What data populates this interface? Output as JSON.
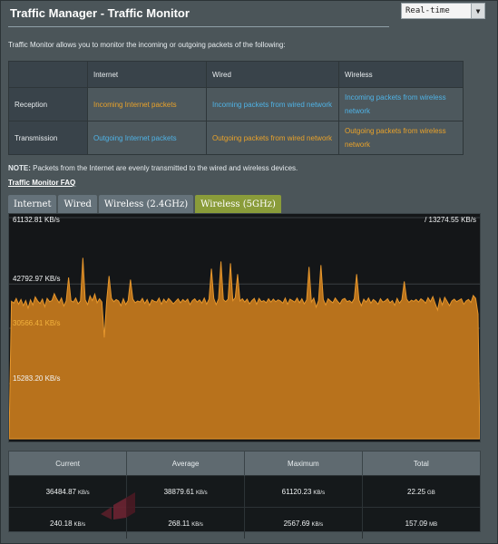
{
  "header": {
    "title": "Traffic Manager - Traffic Monitor",
    "mode_select": "Real-time"
  },
  "intro": "Traffic Monitor allows you to monitor the incoming or outgoing packets of the following:",
  "flow_table": {
    "columns": [
      "",
      "Internet",
      "Wired",
      "Wireless"
    ],
    "rows": [
      {
        "label": "Reception",
        "internet": "Incoming Internet packets",
        "wired": "Incoming packets from wired network",
        "wireless": "Incoming packets from wireless network"
      },
      {
        "label": "Transmission",
        "internet": "Outgoing Internet packets",
        "wired": "Outgoing packets from wired network",
        "wireless": "Outgoing packets from wireless network"
      }
    ]
  },
  "note": {
    "prefix": "NOTE:",
    "text": " Packets from the Internet are evenly transmitted to the wired and wireless devices."
  },
  "faq_link": "Traffic Monitor FAQ",
  "tabs": [
    "Internet",
    "Wired",
    "Wireless (2.4GHz)",
    "Wireless (5GHz)"
  ],
  "active_tab": 3,
  "colors": {
    "reception": "#f2a92a",
    "transmission": "#49b0ea",
    "active_tab": "#8a9c3a"
  },
  "chart_data": {
    "type": "area",
    "ylim": [
      0,
      61132.81
    ],
    "y_ticks": [
      "61132.81 KB/s",
      "42792.97 KB/s",
      "30566.41 KB/s",
      "15283.20 KB/s"
    ],
    "top_right": "/ 13274.55 KB/s",
    "series": [
      {
        "name": "Reception",
        "values": [
          0,
          38000,
          37500,
          38800,
          37200,
          38500,
          36800,
          38200,
          36100,
          38400,
          37000,
          39200,
          38100,
          37400,
          38600,
          36500,
          38800,
          37900,
          38200,
          40100,
          38700,
          37600,
          38900,
          36700,
          38100,
          44600,
          38200,
          37800,
          38900,
          37300,
          38100,
          50000,
          38400,
          37100,
          39500,
          38200,
          40000,
          37600,
          38700,
          37800,
          28000,
          38200,
          45000,
          38800,
          37900,
          38500,
          38100,
          36800,
          38700,
          37100,
          38200,
          44000,
          38600,
          37600,
          38100,
          37800,
          38800,
          37400,
          38500,
          36900,
          38400,
          38000,
          37800,
          38900,
          37200,
          38600,
          37700,
          38800,
          38100,
          37300,
          38000,
          38700,
          37600,
          38500,
          37900,
          38600,
          37100,
          38200,
          38700,
          37800,
          38400,
          37500,
          38900,
          37200,
          38600,
          47000,
          38800,
          37100,
          38700,
          49000,
          38500,
          37900,
          38600,
          48500,
          38200,
          39000,
          45500,
          38100,
          38700,
          37800,
          38600,
          37300,
          38200,
          38800,
          37200,
          38800,
          37900,
          38200,
          37600,
          38700,
          37800,
          38600,
          37900,
          38400,
          38100,
          37500,
          38900,
          37200,
          38600,
          38200,
          37800,
          38900,
          37600,
          38700,
          37300,
          38400,
          47500,
          37800,
          38900,
          36400,
          38200,
          48000,
          38500,
          37000,
          38700,
          38100,
          37600,
          38900,
          38000,
          37300,
          38500,
          38800,
          37900,
          38200,
          37600,
          38700,
          45500,
          38300,
          36800,
          38600,
          37800,
          38900,
          37500,
          38500,
          38000,
          37200,
          38700,
          37800,
          38100,
          38700,
          37600,
          38200,
          36900,
          38800,
          37500,
          38400,
          43500,
          38600,
          37700,
          38300,
          38000,
          38500,
          37800,
          38700,
          38200,
          37500,
          39000,
          37900,
          39300,
          37400,
          35600,
          38800,
          37000,
          39100,
          38000,
          36800,
          38100,
          38600,
          37900,
          38300,
          38700,
          37200,
          38100,
          38500,
          37700,
          39600,
          38800,
          34500
        ]
      }
    ]
  },
  "stats": {
    "headers": [
      "Current",
      "Average",
      "Maximum",
      "Total"
    ],
    "rows": [
      {
        "current": "36484.87",
        "current_unit": "KB/s",
        "average": "38879.61",
        "average_unit": "KB/s",
        "maximum": "61120.23",
        "maximum_unit": "KB/s",
        "total": "22.25",
        "total_unit": "GB"
      },
      {
        "current": "240.18",
        "current_unit": "KB/s",
        "average": "268.11",
        "average_unit": "KB/s",
        "maximum": "2567.69",
        "maximum_unit": "KB/s",
        "total": "157.09",
        "total_unit": "MB"
      }
    ]
  }
}
